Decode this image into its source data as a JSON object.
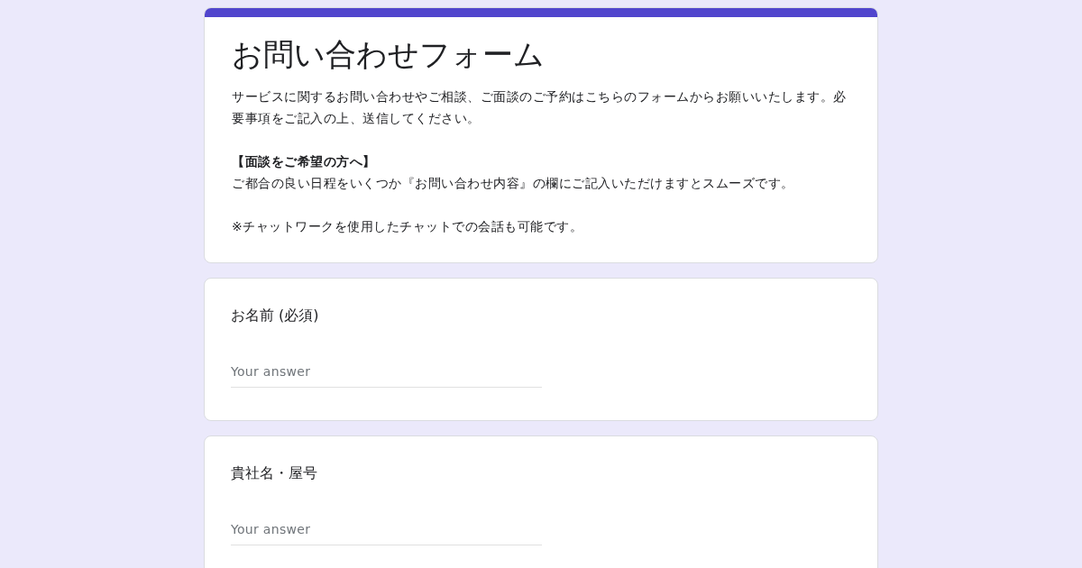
{
  "form": {
    "title": "お問い合わせフォーム",
    "description": [
      {
        "text": "サービスに関するお問い合わせやご相談、ご面談のご予約はこちらのフォームからお願いいたします。必要事項をご記入の上、送信してください。"
      },
      {
        "text": "【面談をご希望の方へ】",
        "bold": true
      },
      {
        "text": "ご都合の良い日程をいくつか『お問い合わせ内容』の欄にご記入いただけますとスムーズです。"
      },
      {
        "text": "※チャットワークを使用したチャットでの会話も可能です。"
      }
    ]
  },
  "questions": [
    {
      "label": "お名前 (必須)",
      "placeholder": "Your answer"
    },
    {
      "label": "貴社名・屋号",
      "placeholder": "Your answer"
    }
  ]
}
